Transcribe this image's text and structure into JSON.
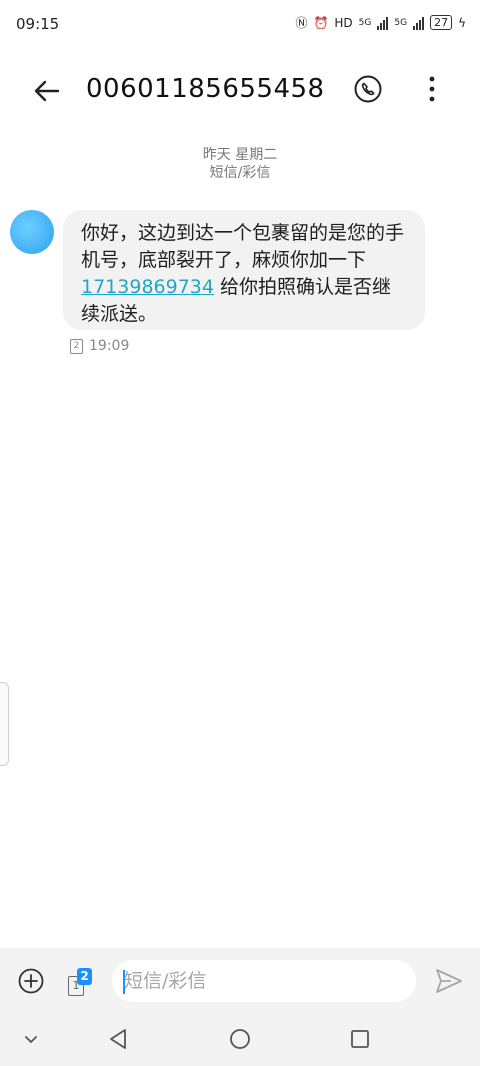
{
  "status_bar": {
    "time": "09:15",
    "network_a": "HD",
    "network_b": "5G",
    "network_c": "5G",
    "battery": "27"
  },
  "header": {
    "title": "00601185655458",
    "back_icon": "arrow-left-icon",
    "call_icon": "phone-icon",
    "more_icon": "more-vertical-icon"
  },
  "conversation": {
    "date_label": "昨天 星期二",
    "type_label": "短信/彩信",
    "messages": [
      {
        "text_part1": "你好，这边到达一个包裹留的是您的手机号，底部裂开了，麻烦你加一下",
        "link": "17139869734",
        "text_part2": " 给你拍照确认是否继续派送。",
        "sim": "2",
        "time": "19:09"
      }
    ]
  },
  "composer": {
    "placeholder": "短信/彩信",
    "sim_front": "1",
    "sim_badge": "2"
  },
  "colors": {
    "accent": "#1e8fff",
    "link": "#1fa7c7",
    "bubble": "#f2f2f2",
    "avatar": "#3fb4fb"
  }
}
